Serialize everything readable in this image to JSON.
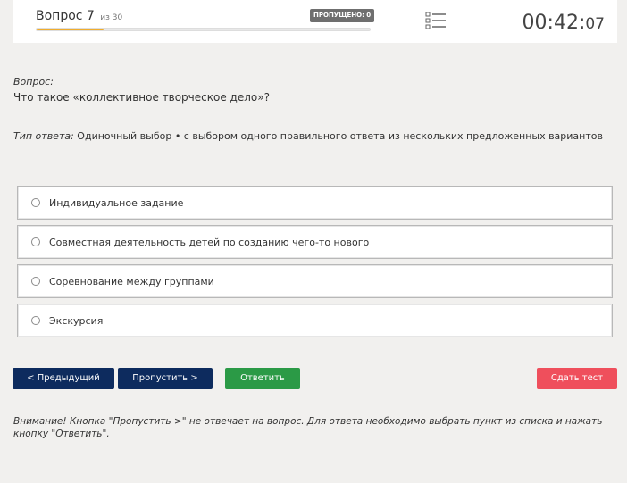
{
  "header": {
    "question_label": "Вопрос 7",
    "of_label": "из 30",
    "skipped_badge": "ПРОПУЩЕНО: 0",
    "progress_fraction": 0.2,
    "timer_main": "00:42:",
    "timer_seconds": "07"
  },
  "question": {
    "label": "Вопрос:",
    "text": "Что такое «коллективное творческое дело»?",
    "type_label": "Тип ответа:",
    "type_text": " Одиночный выбор • с выбором одного правильного ответа из нескольких предложенных вариантов"
  },
  "options": [
    {
      "label": "Индивидуальное задание"
    },
    {
      "label": "Совместная деятельность детей по созданию чего-то нового"
    },
    {
      "label": "Соревнование между группами"
    },
    {
      "label": "Экскурсия"
    }
  ],
  "buttons": {
    "prev": "< Предыдущий",
    "skip": "Пропустить >",
    "answer": "Ответить",
    "finish": "Сдать тест"
  },
  "notice": "Внимание! Кнопка \"Пропустить >\" не отвечает на вопрос. Для ответа необходимо выбрать пункт из списка и нажать кнопку \"Ответить\".",
  "colors": {
    "progress": "#f0ad2e",
    "nav_button": "#0d2b5e",
    "answer_button": "#2b9a46",
    "finish_button": "#ef4f5c"
  },
  "icons": {
    "question_list": "list-icon"
  }
}
